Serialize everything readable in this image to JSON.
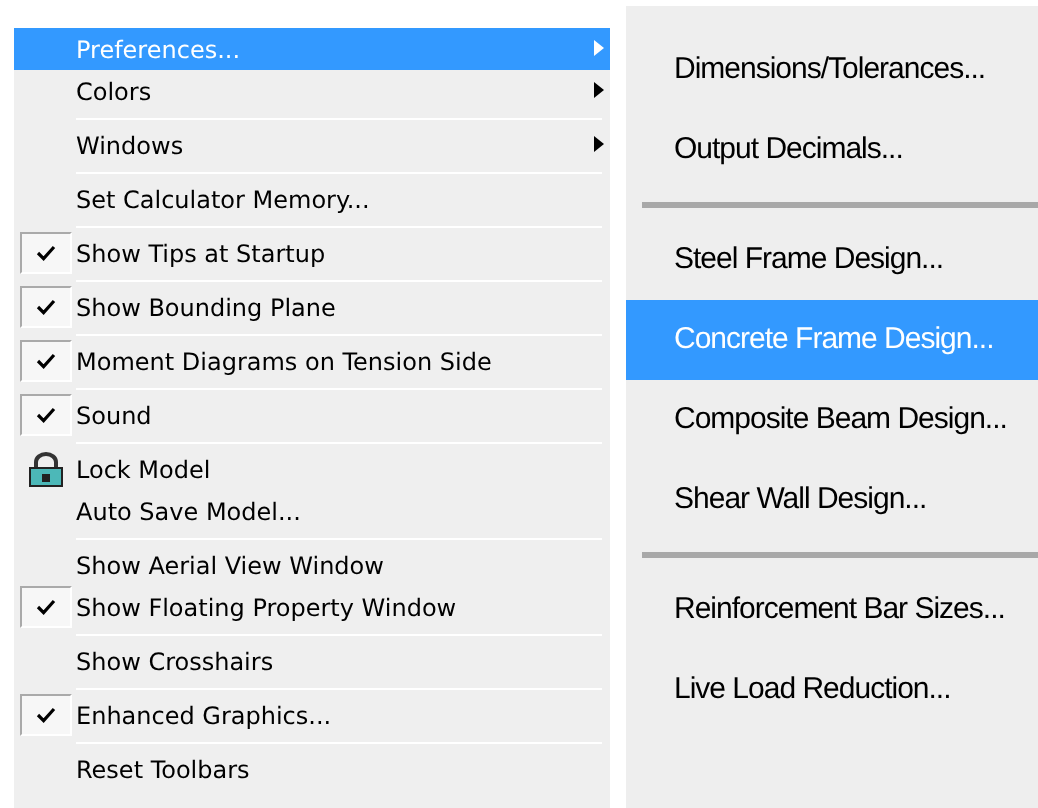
{
  "menu": [
    {
      "kind": "item",
      "label": "Preferences...",
      "selected": true,
      "submenu": true
    },
    {
      "kind": "item",
      "label": "Colors",
      "selected": false,
      "submenu": true
    },
    {
      "kind": "separator"
    },
    {
      "kind": "item",
      "label": "Windows",
      "selected": false,
      "submenu": true
    },
    {
      "kind": "separator"
    },
    {
      "kind": "item",
      "label": "Set Calculator Memory...",
      "selected": false
    },
    {
      "kind": "separator"
    },
    {
      "kind": "check",
      "label": "Show Tips at Startup",
      "selected": false,
      "checked": true
    },
    {
      "kind": "separator"
    },
    {
      "kind": "check",
      "label": "Show Bounding Plane",
      "selected": false,
      "checked": true
    },
    {
      "kind": "separator"
    },
    {
      "kind": "check",
      "label": "Moment Diagrams on Tension Side",
      "selected": false,
      "checked": true
    },
    {
      "kind": "separator"
    },
    {
      "kind": "check",
      "label": "Sound",
      "selected": false,
      "checked": true
    },
    {
      "kind": "separator"
    },
    {
      "kind": "lock",
      "label": "Lock Model",
      "selected": false
    },
    {
      "kind": "item",
      "label": "Auto Save Model...",
      "selected": false
    },
    {
      "kind": "separator"
    },
    {
      "kind": "check",
      "label": "Show Aerial View Window",
      "selected": false,
      "checked": false
    },
    {
      "kind": "check",
      "label": "Show Floating Property Window",
      "selected": false,
      "checked": true
    },
    {
      "kind": "separator"
    },
    {
      "kind": "check",
      "label": "Show Crosshairs",
      "selected": false,
      "checked": false
    },
    {
      "kind": "separator"
    },
    {
      "kind": "check",
      "label": "Enhanced Graphics...",
      "selected": false,
      "checked": true
    },
    {
      "kind": "separator"
    },
    {
      "kind": "item",
      "label": "Reset Toolbars",
      "selected": false
    }
  ],
  "submenu": [
    {
      "kind": "item",
      "label": "Dimensions/Tolerances...",
      "selected": false
    },
    {
      "kind": "item",
      "label": "Output Decimals...",
      "selected": false
    },
    {
      "kind": "separator"
    },
    {
      "kind": "item",
      "label": "Steel Frame Design...",
      "selected": false
    },
    {
      "kind": "item",
      "label": "Concrete Frame Design...",
      "selected": true
    },
    {
      "kind": "item",
      "label": "Composite Beam Design...",
      "selected": false
    },
    {
      "kind": "item",
      "label": "Shear Wall Design...",
      "selected": false
    },
    {
      "kind": "separator"
    },
    {
      "kind": "item",
      "label": "Reinforcement Bar Sizes...",
      "selected": false
    },
    {
      "kind": "item",
      "label": "Live Load Reduction...",
      "selected": false
    }
  ]
}
